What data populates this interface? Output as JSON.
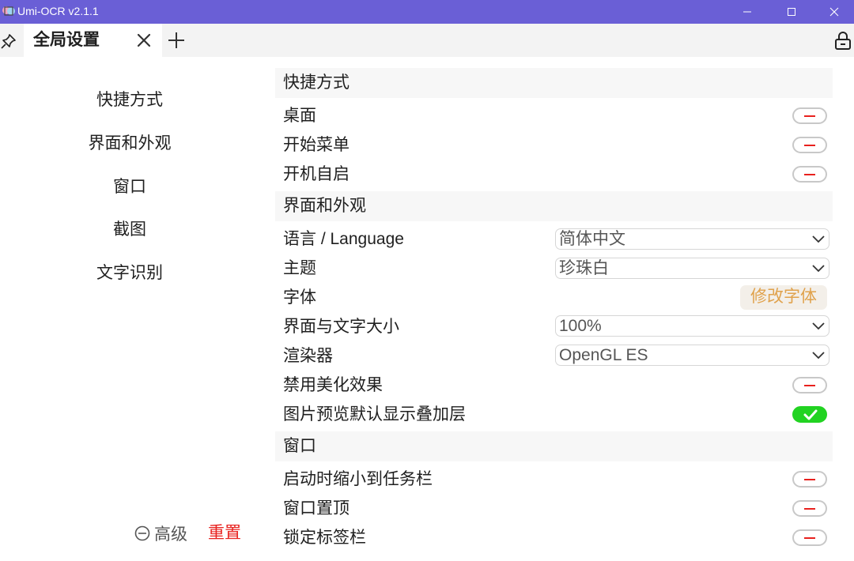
{
  "window": {
    "title": "Umi-OCR v2.1.1",
    "controls": [
      "minimize",
      "maximize",
      "close"
    ]
  },
  "tabs": [
    {
      "title": "全局设置",
      "active": true
    }
  ],
  "sidebar": {
    "items": [
      {
        "label": "快捷方式"
      },
      {
        "label": "界面和外观"
      },
      {
        "label": "窗口"
      },
      {
        "label": "截图"
      },
      {
        "label": "文字识别"
      }
    ],
    "advanced_label": "高级",
    "reset_label": "重置"
  },
  "sections": {
    "shortcuts": {
      "title": "快捷方式",
      "items": [
        {
          "label": "桌面",
          "value": false
        },
        {
          "label": "开始菜单",
          "value": false
        },
        {
          "label": "开机自启",
          "value": false
        }
      ]
    },
    "appearance": {
      "title": "界面和外观",
      "language": {
        "label": "语言 / Language",
        "value": "简体中文"
      },
      "theme": {
        "label": "主题",
        "value": "珍珠白"
      },
      "font": {
        "label": "字体",
        "button": "修改字体"
      },
      "scale": {
        "label": "界面与文字大小",
        "value": "100%"
      },
      "renderer": {
        "label": "渲染器",
        "value": "OpenGL ES"
      },
      "disable_effects": {
        "label": "禁用美化效果",
        "value": false
      },
      "overlay": {
        "label": "图片预览默认显示叠加层",
        "value": true
      }
    },
    "window": {
      "title": "窗口",
      "items": [
        {
          "label": "启动时缩小到任务栏",
          "value": false
        },
        {
          "label": "窗口置顶",
          "value": false
        },
        {
          "label": "锁定标签栏",
          "value": false
        }
      ]
    }
  },
  "colors": {
    "titlebar": "#6a5fd6",
    "toggle_on": "#22d322",
    "toggle_off_mark": "#e8211e",
    "reset": "#e8211e",
    "font_button_text": "#e0a24c"
  }
}
